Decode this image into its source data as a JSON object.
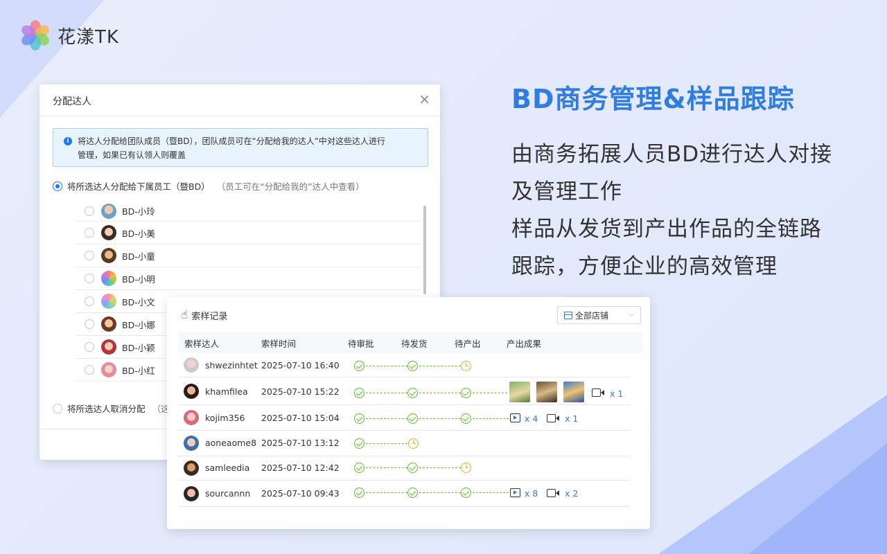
{
  "brand": {
    "name": "花漾TK"
  },
  "headline": "BD商务管理&样品跟踪",
  "description": [
    "由商务拓展人员BD进行达人对接",
    "及管理工作",
    "样品从发货到产出作品的全链路",
    "跟踪，方便企业的高效管理"
  ],
  "assign_dialog": {
    "title": "分配达人",
    "close_icon": "close-icon",
    "alert_lines": [
      "将达人分配给团队成员（暨BD），团队成员可在“分配给我的达人”中对这些达人进行",
      "管理，如果已有认领人则覆盖"
    ],
    "option_assign": {
      "label": "将所选达人分配给下属员工（暨BD）",
      "note": "（员工可在“分配给我的”达人中查看）",
      "selected": true
    },
    "members": [
      "BD-小玲",
      "BD-小美",
      "BD-小童",
      "BD-小明",
      "BD-小文",
      "BD-小娜",
      "BD-小颖",
      "BD-小红"
    ],
    "option_unassign": {
      "label": "将所选达人取消分配",
      "note": "（这"
    }
  },
  "sample_record": {
    "title": "索样记录",
    "store_select": "全部店铺",
    "columns": [
      "索样达人",
      "索样时间",
      "待审批",
      "待发货",
      "待产出",
      "产出成果"
    ],
    "rows": [
      {
        "name": "shwezinhtet",
        "time": "2025-07-10 16:40",
        "stages": [
          "done",
          "done",
          "pending"
        ],
        "outputs": []
      },
      {
        "name": "khamfilea",
        "time": "2025-07-10 15:22",
        "stages": [
          "done",
          "done",
          "done"
        ],
        "outputs": [
          {
            "type": "video",
            "count": "x 1"
          }
        ]
      },
      {
        "name": "kojim356",
        "time": "2025-07-10 15:04",
        "stages": [
          "done",
          "done",
          "done"
        ],
        "outputs": [
          {
            "type": "play",
            "count": "x 4"
          },
          {
            "type": "video",
            "count": "x 1"
          }
        ]
      },
      {
        "name": "aoneaome8",
        "time": "2025-07-10 13:12",
        "stages": [
          "done",
          "pending"
        ],
        "outputs": []
      },
      {
        "name": "samleedia",
        "time": "2025-07-10 12:42",
        "stages": [
          "done",
          "done",
          "pending"
        ],
        "outputs": []
      },
      {
        "name": "sourcannn",
        "time": "2025-07-10 09:43",
        "stages": [
          "done",
          "done",
          "done"
        ],
        "outputs": [
          {
            "type": "play",
            "count": "x 8"
          },
          {
            "type": "video",
            "count": "x 2"
          }
        ]
      }
    ]
  },
  "colors": {
    "accent": "#2f7de1",
    "done": "#52c41a",
    "pending": "#f5a623",
    "info": "#1677ff"
  }
}
